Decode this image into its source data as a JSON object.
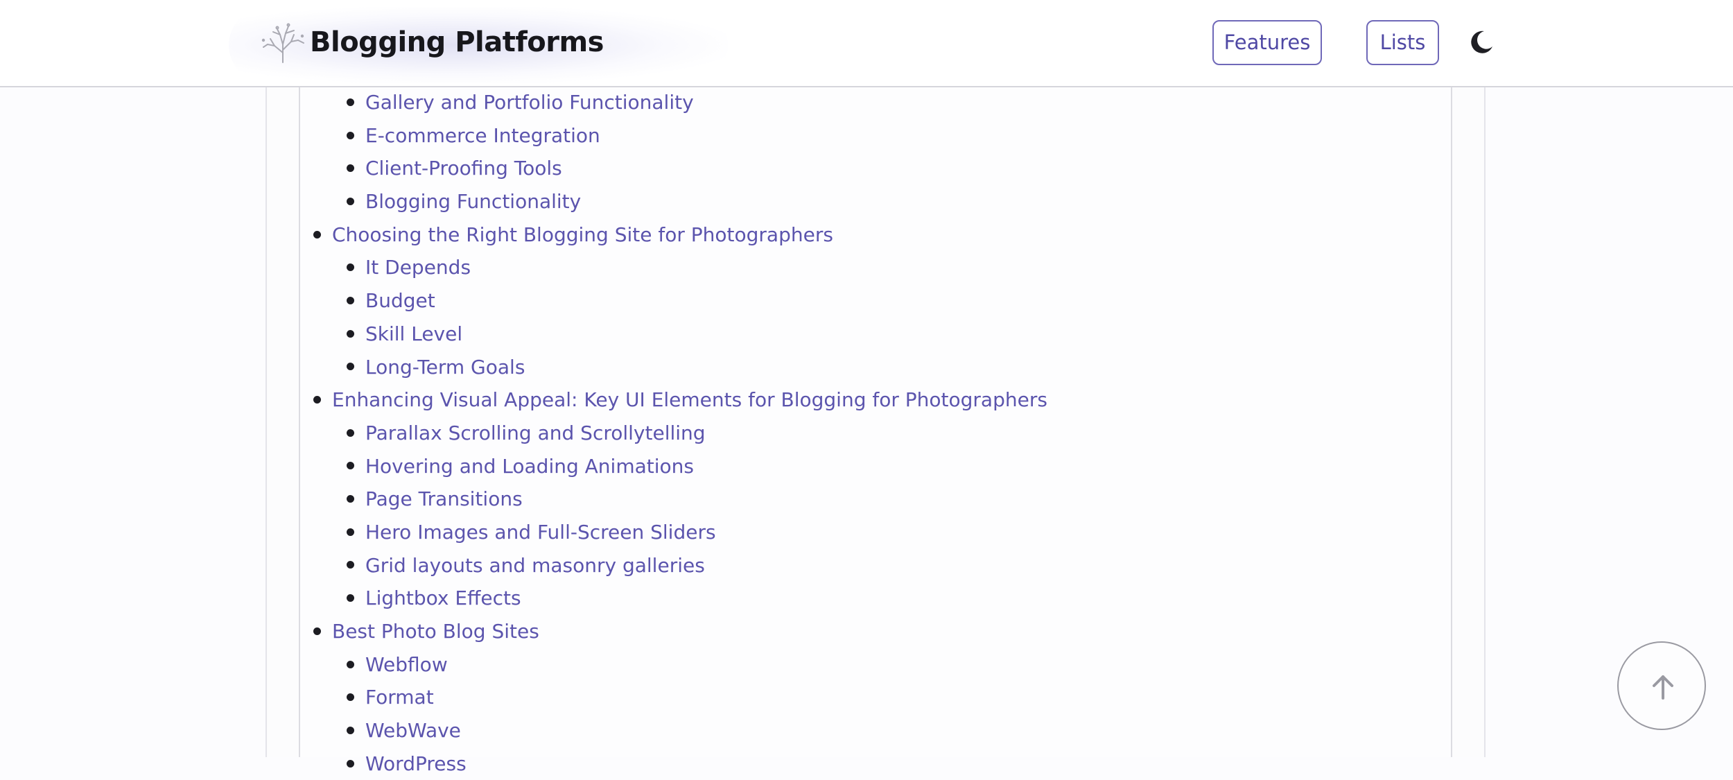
{
  "header": {
    "brand": "Blogging Platforms",
    "nav": [
      {
        "label": "Features"
      },
      {
        "label": "Lists"
      }
    ],
    "logo_icon": "tree-icon",
    "theme_icon": "moon-icon"
  },
  "toc": {
    "items": [
      {
        "label": "Gallery and Portfolio Functionality",
        "level": 2
      },
      {
        "label": "E-commerce Integration",
        "level": 2
      },
      {
        "label": "Client-Proofing Tools",
        "level": 2
      },
      {
        "label": "Blogging Functionality",
        "level": 2
      },
      {
        "label": "Choosing the Right Blogging Site for Photographers",
        "level": 1
      },
      {
        "label": "It Depends",
        "level": 2
      },
      {
        "label": "Budget",
        "level": 2
      },
      {
        "label": "Skill Level",
        "level": 2
      },
      {
        "label": "Long-Term Goals",
        "level": 2
      },
      {
        "label": "Enhancing Visual Appeal: Key UI Elements for Blogging for Photographers",
        "level": 1
      },
      {
        "label": "Parallax Scrolling and Scrollytelling",
        "level": 2
      },
      {
        "label": "Hovering and Loading Animations",
        "level": 2
      },
      {
        "label": "Page Transitions",
        "level": 2
      },
      {
        "label": "Hero Images and Full-Screen Sliders",
        "level": 2
      },
      {
        "label": "Grid layouts and masonry galleries",
        "level": 2
      },
      {
        "label": "Lightbox Effects",
        "level": 2
      },
      {
        "label": "Best Photo Blog Sites",
        "level": 1
      },
      {
        "label": "Webflow",
        "level": 2
      },
      {
        "label": "Format",
        "level": 2
      },
      {
        "label": "WebWave",
        "level": 2
      },
      {
        "label": "WordPress",
        "level": 2
      }
    ]
  },
  "scroll_top": {
    "icon": "arrow-up-icon"
  },
  "colors": {
    "link": "#5b54ad",
    "button_border": "#6f68b8",
    "text_dark": "#17171c"
  }
}
